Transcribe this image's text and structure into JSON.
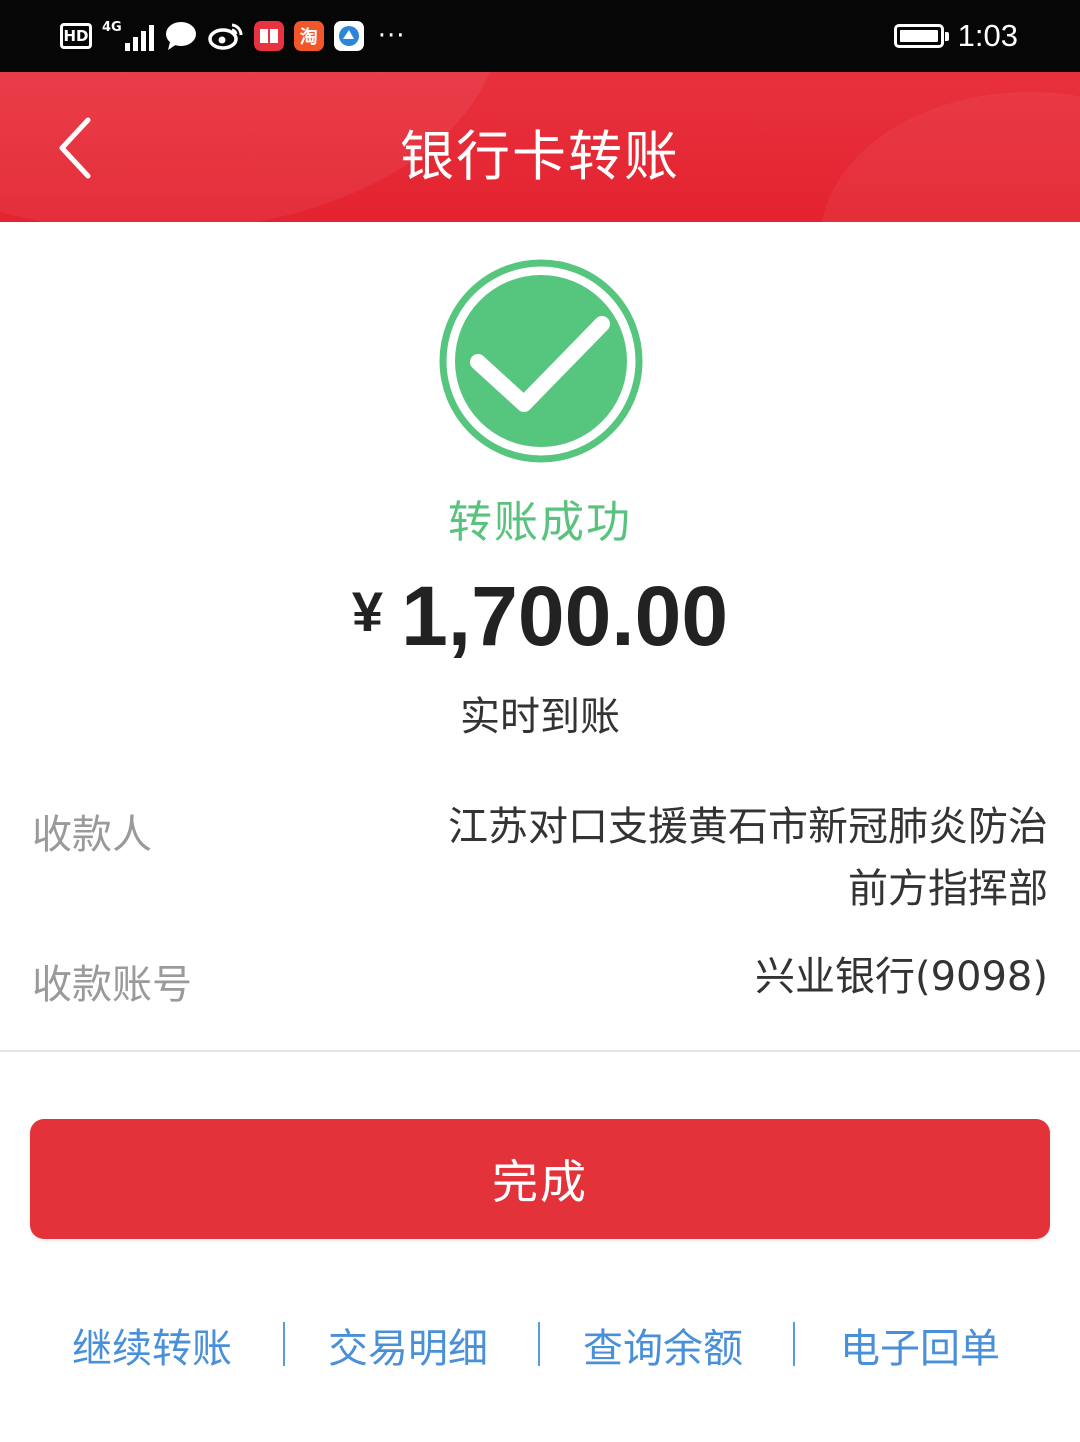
{
  "status_bar": {
    "hd": "HD",
    "network": "4G",
    "taobao_icon_text": "淘",
    "more": "···",
    "time": "1:03"
  },
  "header": {
    "title": "银行卡转账",
    "back_icon": "chevron-left-icon"
  },
  "result": {
    "icon": "check-circle-icon",
    "status": "转账成功",
    "currency": "¥",
    "amount": "1,700.00",
    "arrival": "实时到账"
  },
  "details": {
    "payee_label": "收款人",
    "payee_line1": "江苏对口支援黄石市新冠肺炎防治",
    "payee_line2": "前方指挥部",
    "account_label": "收款账号",
    "account_value": "兴业银行(9098)"
  },
  "actions": {
    "done_label": "完成",
    "links": [
      "继续转账",
      "交易明细",
      "查询余额",
      "电子回单"
    ],
    "separator": "|"
  },
  "colors": {
    "status_bar": "#060606",
    "header": "#e3232f",
    "success": "#59c27d",
    "button": "#e3323a",
    "link": "#4a90d9"
  }
}
